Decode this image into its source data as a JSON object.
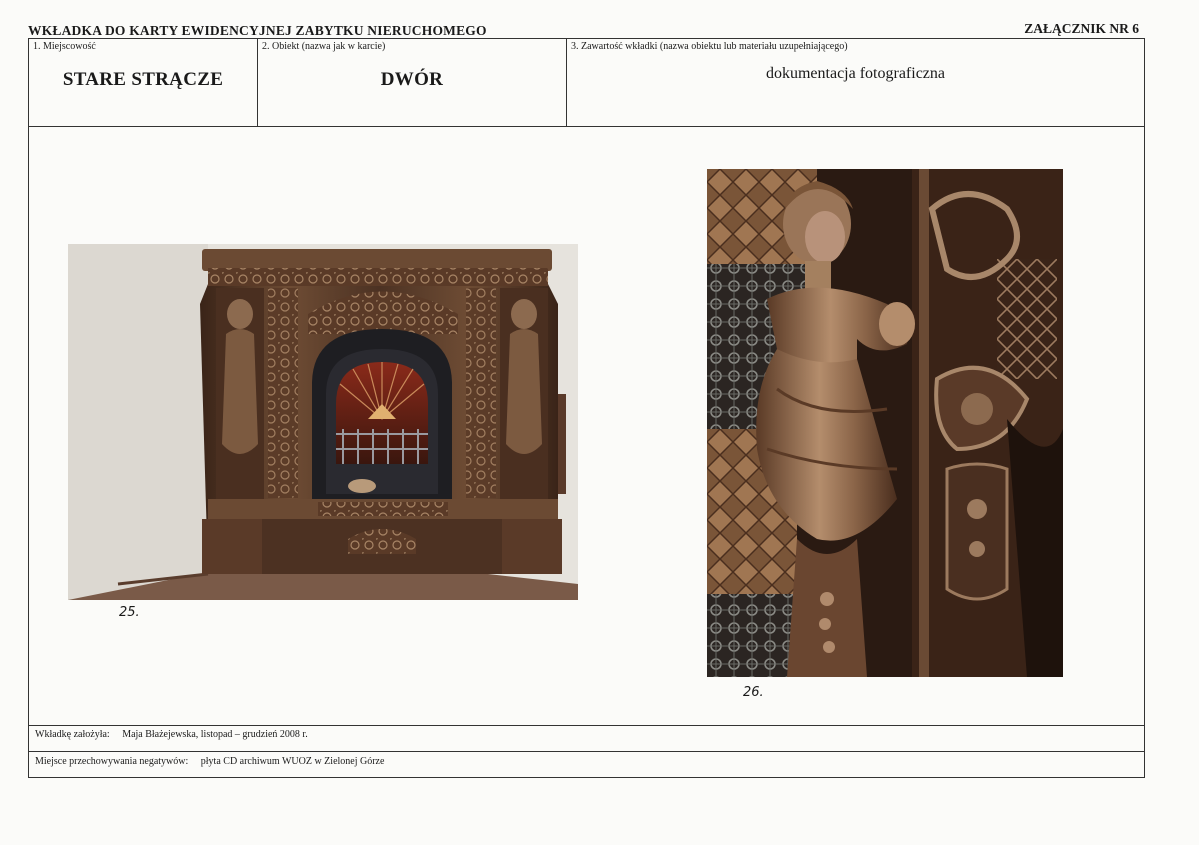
{
  "header": {
    "title": "WKŁADKA DO KARTY EWIDENCYJNEJ ZABYTKU NIERUCHOMEGO",
    "annex": "ZAŁĄCZNIK NR 6"
  },
  "fields": {
    "locality": {
      "label": "1. Miejscowość",
      "value": "STARE STRĄCZE"
    },
    "object": {
      "label": "2. Obiekt (nazwa jak w karcie)",
      "value": "DWÓR"
    },
    "contents": {
      "label": "3. Zawartość wkładki (nazwa obiektu lub materiału uzupełniającego)",
      "value": "dokumentacja fotograficzna"
    }
  },
  "photos": [
    {
      "caption": "25."
    },
    {
      "caption": "26."
    }
  ],
  "footer": {
    "author_label": "Wkładkę założyła:",
    "author_value": "Maja Błażejewska, listopad – grudzień 2008 r.",
    "storage_label": "Miejsce przechowywania negatywów:",
    "storage_value": "płyta CD archiwum WUOZ w Zielonej Górze"
  },
  "colors": {
    "stove_brown": "#4a3020",
    "glaze_highlight": "#a58468",
    "wall": "#e4e1db"
  }
}
